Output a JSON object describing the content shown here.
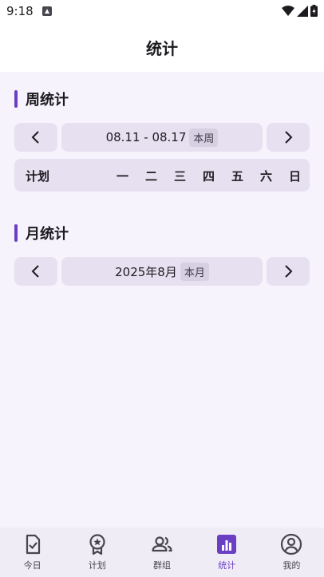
{
  "status_bar": {
    "time": "9:18"
  },
  "app_bar": {
    "title": "统计"
  },
  "week_section": {
    "title": "周统计",
    "range": "08.11 - 08.17",
    "range_tag": "本周",
    "header": {
      "plan_label": "计划",
      "days": [
        "一",
        "二",
        "三",
        "四",
        "五",
        "六",
        "日"
      ]
    }
  },
  "month_section": {
    "title": "月统计",
    "month": "2025年8月",
    "month_tag": "本月"
  },
  "bottom_nav": {
    "items": [
      {
        "label": "今日",
        "icon": "today-check-icon",
        "active": false
      },
      {
        "label": "计划",
        "icon": "plan-badge-icon",
        "active": false
      },
      {
        "label": "群组",
        "icon": "group-people-icon",
        "active": false
      },
      {
        "label": "统计",
        "icon": "stats-bar-icon",
        "active": true
      },
      {
        "label": "我的",
        "icon": "profile-person-icon",
        "active": false
      }
    ]
  },
  "colors": {
    "accent": "#6a3fc4",
    "background": "#f7f3fc",
    "surface": "#e6e0f0",
    "tag_background": "#d7d0e3"
  }
}
